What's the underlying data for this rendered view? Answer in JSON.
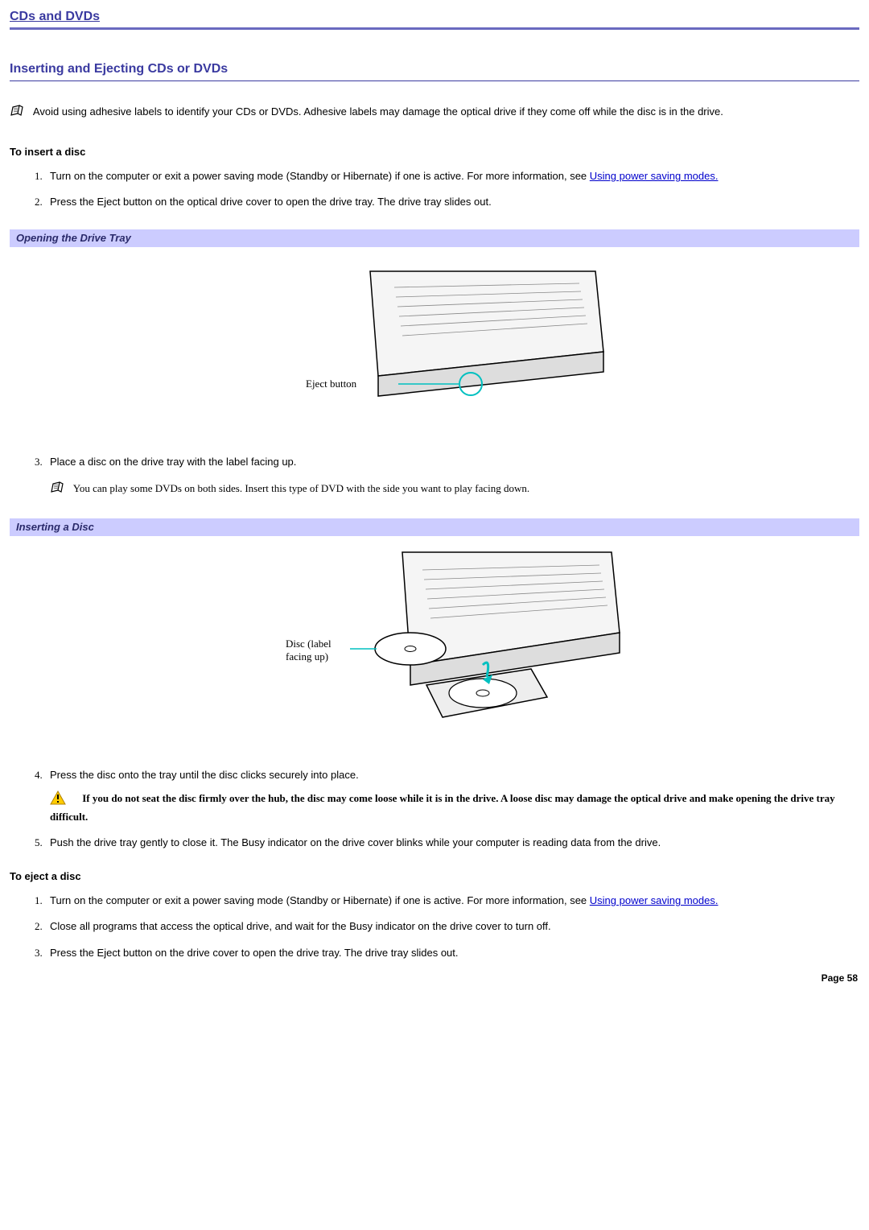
{
  "chapter_title": "CDs and DVDs",
  "section_title": "Inserting and Ejecting CDs or DVDs",
  "intro_note": "Avoid using adhesive labels to identify your CDs or DVDs. Adhesive labels may damage the optical drive if they come off while the disc is in the drive.",
  "insert": {
    "heading": "To insert a disc",
    "step1_pre": "Turn on the computer or exit a power saving mode (Standby or Hibernate) if one is active. For more information, see ",
    "step1_link": "Using power saving modes.",
    "step2": "Press the Eject button on the optical drive cover to open the drive tray. The drive tray slides out.",
    "step3": "Place a disc on the drive tray with the label facing up.",
    "step3_note": "You can play some DVDs on both sides. Insert this type of DVD with the side you want to play facing down.",
    "step4": "Press the disc onto the tray until the disc clicks securely into place.",
    "step4_caution": "If you do not seat the disc firmly over the hub, the disc may come loose while it is in the drive. A loose disc may damage the optical drive and make opening the drive tray difficult.",
    "step5": "Push the drive tray gently to close it. The Busy indicator on the drive cover blinks while your computer is reading data from the drive."
  },
  "figure1": {
    "caption": "Opening the Drive Tray",
    "callout": "Eject button"
  },
  "figure2": {
    "caption": "Inserting a Disc",
    "callout1": "Disc (label",
    "callout2": "facing up)"
  },
  "eject": {
    "heading": "To eject a disc",
    "step1_pre": "Turn on the computer or exit a power saving mode (Standby or Hibernate) if one is active. For more information, see ",
    "step1_link": "Using power saving modes.",
    "step2": "Close all programs that access the optical drive, and wait for the Busy indicator on the drive cover to turn off.",
    "step3": "Press the Eject button on the drive cover to open the drive tray. The drive tray slides out."
  },
  "page_number": "Page 58"
}
